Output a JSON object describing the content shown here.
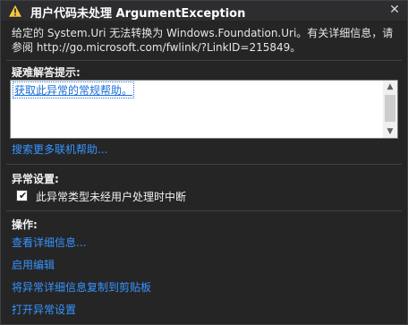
{
  "dialog": {
    "title": "用户代码未处理 ArgumentException",
    "close_glyph": "✕",
    "message_line1": "给定的 System.Uri 无法转换为 Windows.Foundation.Uri。有关详细信息，请",
    "message_line2": "参阅 http://go.microsoft.com/fwlink/?LinkID=215849。"
  },
  "troubleshooting": {
    "heading": "疑难解答提示:",
    "tip_link": "获取此异常的常规帮助。",
    "more_help_link": "搜索更多联机帮助...",
    "scroll_up": "▲",
    "scroll_down": "▼"
  },
  "exception_settings": {
    "heading": "异常设置:",
    "checkbox_checked": true,
    "checkbox_mark": "✔",
    "checkbox_label": "此异常类型未经用户处理时中断"
  },
  "actions": {
    "heading": "操作:",
    "items": [
      "查看详细信息...",
      "启用编辑",
      "将异常详细信息复制到剪贴板",
      "打开异常设置"
    ]
  },
  "colors": {
    "background": "#252526",
    "link": "#3794ff",
    "warning": "#f2c744"
  }
}
